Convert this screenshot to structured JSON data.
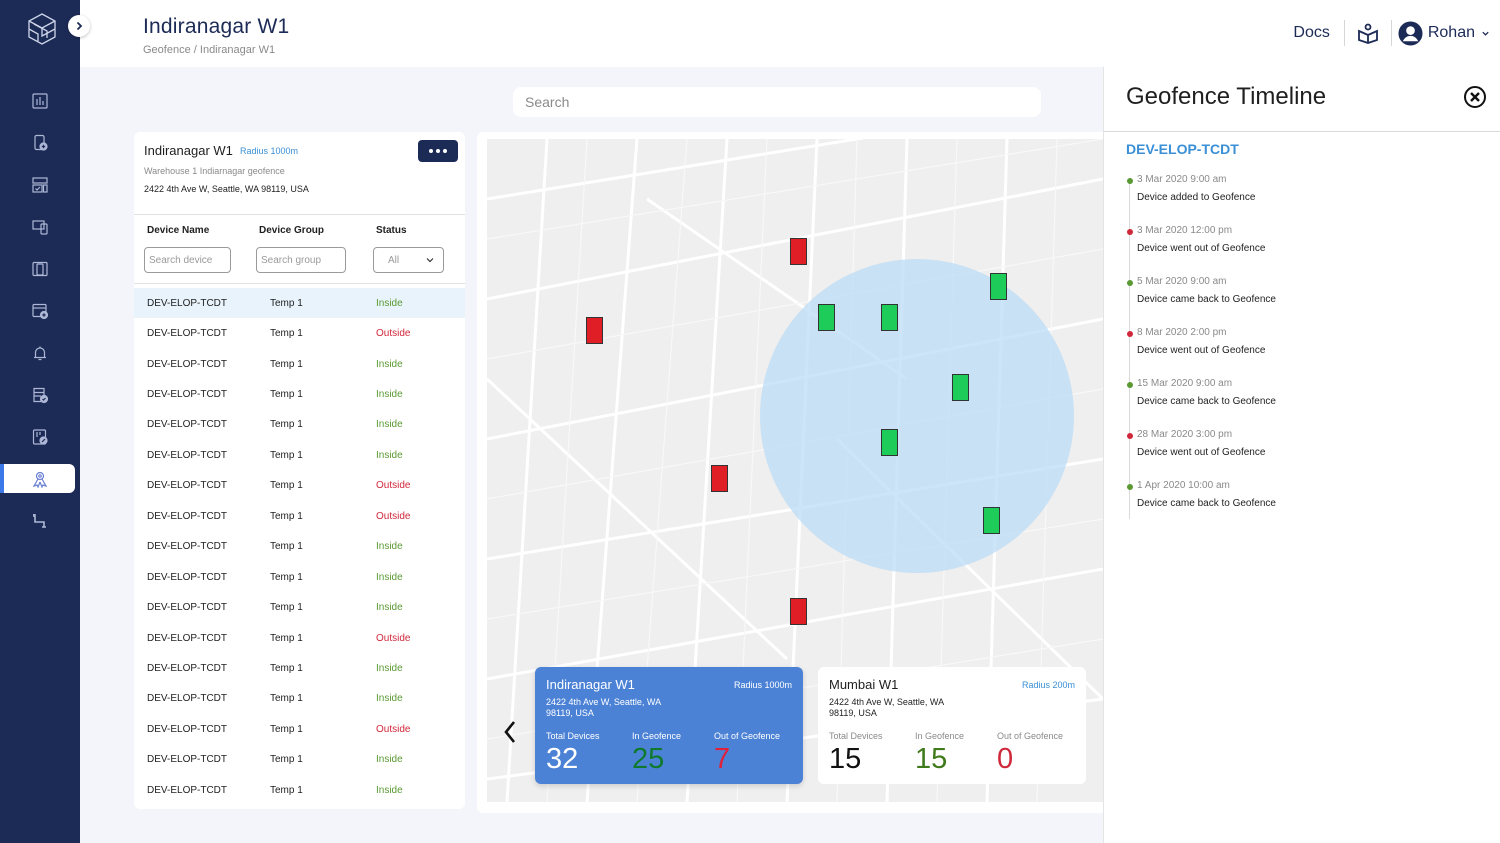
{
  "header": {
    "title": "Indiranagar W1",
    "breadcrumb": [
      "Geofence /",
      "Indiranagar W1"
    ],
    "docs_label": "Docs",
    "user_name": "Rohan"
  },
  "sidebar": {
    "items": [
      {
        "icon": "analytics-icon"
      },
      {
        "icon": "add-device-icon"
      },
      {
        "icon": "dashboard-layout-icon"
      },
      {
        "icon": "devices-icon"
      },
      {
        "icon": "device-group-icon"
      },
      {
        "icon": "add-window-icon"
      },
      {
        "icon": "bell-icon"
      },
      {
        "icon": "verified-list-icon"
      },
      {
        "icon": "device-report-icon"
      },
      {
        "icon": "geofence-icon",
        "active": true
      },
      {
        "icon": "pipeline-icon"
      }
    ]
  },
  "search": {
    "placeholder": "Search"
  },
  "geofence_card": {
    "name": "Indiranagar W1",
    "radius": "Radius 1000m",
    "description": "Warehouse 1 Indiarnagar geofence",
    "address": "2422 4th Ave W, Seattle, WA 98119, USA",
    "columns": [
      "Device Name",
      "Device Group",
      "Status"
    ],
    "filters": {
      "device_placeholder": "Search device",
      "group_placeholder": "Search group",
      "status_value": "All"
    },
    "rows": [
      {
        "name": "DEV-ELOP-TCDT",
        "group": "Temp 1",
        "status": "Inside",
        "selected": true
      },
      {
        "name": "DEV-ELOP-TCDT",
        "group": "Temp 1",
        "status": "Outside"
      },
      {
        "name": "DEV-ELOP-TCDT",
        "group": "Temp 1",
        "status": "Inside"
      },
      {
        "name": "DEV-ELOP-TCDT",
        "group": "Temp 1",
        "status": "Inside"
      },
      {
        "name": "DEV-ELOP-TCDT",
        "group": "Temp 1",
        "status": "Inside"
      },
      {
        "name": "DEV-ELOP-TCDT",
        "group": "Temp 1",
        "status": "Inside"
      },
      {
        "name": "DEV-ELOP-TCDT",
        "group": "Temp 1",
        "status": "Outside"
      },
      {
        "name": "DEV-ELOP-TCDT",
        "group": "Temp 1",
        "status": "Outside"
      },
      {
        "name": "DEV-ELOP-TCDT",
        "group": "Temp 1",
        "status": "Inside"
      },
      {
        "name": "DEV-ELOP-TCDT",
        "group": "Temp 1",
        "status": "Inside"
      },
      {
        "name": "DEV-ELOP-TCDT",
        "group": "Temp 1",
        "status": "Inside"
      },
      {
        "name": "DEV-ELOP-TCDT",
        "group": "Temp 1",
        "status": "Outside"
      },
      {
        "name": "DEV-ELOP-TCDT",
        "group": "Temp 1",
        "status": "Inside"
      },
      {
        "name": "DEV-ELOP-TCDT",
        "group": "Temp 1",
        "status": "Inside"
      },
      {
        "name": "DEV-ELOP-TCDT",
        "group": "Temp 1",
        "status": "Outside"
      },
      {
        "name": "DEV-ELOP-TCDT",
        "group": "Temp 1",
        "status": "Inside"
      },
      {
        "name": "DEV-ELOP-TCDT",
        "group": "Temp 1",
        "status": "Inside"
      }
    ]
  },
  "map": {
    "markers": [
      {
        "status": "out"
      },
      {
        "status": "out"
      },
      {
        "status": "out"
      },
      {
        "status": "out"
      },
      {
        "status": "in"
      },
      {
        "status": "in"
      },
      {
        "status": "in"
      },
      {
        "status": "in"
      },
      {
        "status": "in"
      },
      {
        "status": "in"
      }
    ],
    "summaries": [
      {
        "name": "Indiranagar W1",
        "radius": "Radius 1000m",
        "address": "2422 4th Ave W, Seattle, WA 98119, USA",
        "labels": [
          "Total Devices",
          "In Geofence",
          "Out of  Geofence"
        ],
        "total": "32",
        "in": "25",
        "out": "7",
        "active": true
      },
      {
        "name": "Mumbai W1",
        "radius": "Radius 200m",
        "address": "2422 4th Ave W, Seattle, WA 98119, USA",
        "labels": [
          "Total Devices",
          "In Geofence",
          "Out of  Geofence"
        ],
        "total": "15",
        "in": "15",
        "out": "0",
        "active": false
      }
    ]
  },
  "timeline": {
    "title": "Geofence Timeline",
    "device": "DEV-ELOP-TCDT",
    "events": [
      {
        "time": "3 Mar 2020 9:00 am",
        "text": "Device added to Geofence",
        "type": "green"
      },
      {
        "time": "3 Mar 2020 12:00 pm",
        "text": "Device went out of Geofence",
        "type": "red"
      },
      {
        "time": "5 Mar 2020 9:00 am",
        "text": "Device came back to Geofence",
        "type": "green"
      },
      {
        "time": "8 Mar 2020 2:00 pm",
        "text": "Device went out of Geofence",
        "type": "red"
      },
      {
        "time": "15 Mar 2020 9:00 am",
        "text": "Device came back to Geofence",
        "type": "green"
      },
      {
        "time": "28 Mar 2020 3:00 pm",
        "text": "Device went out of Geofence",
        "type": "red"
      },
      {
        "time": "1 Apr 2020 10:00 am",
        "text": "Device came back to Geofence",
        "type": "green"
      }
    ]
  },
  "colors": {
    "sidebar": "#1c2a56",
    "accent": "#3a8fd6",
    "inside": "#5a9a33",
    "outside": "#d0283b",
    "active_card": "#4c82d6"
  }
}
